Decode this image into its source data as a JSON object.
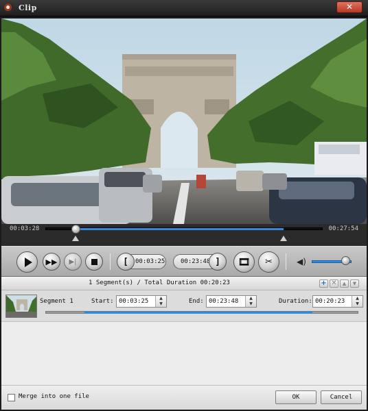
{
  "window": {
    "title": "Clip",
    "close_label": "✕"
  },
  "player": {
    "current_time": "00:03:28",
    "total_time": "00:27:54",
    "progress": 0.11,
    "trim_start_fraction": 0.11,
    "trim_end_fraction": 0.86,
    "start_time": "00:03:25",
    "end_time": "00:23:48",
    "volume": 0.85
  },
  "segments": {
    "summary": "1 Segment(s) / Total Duration 00:20:23",
    "items": [
      {
        "name": "Segment 1",
        "start_label": "Start:",
        "start": "00:03:25",
        "end_label": "End:",
        "end": "00:23:48",
        "duration_label": "Duration:",
        "duration": "00:20:23"
      }
    ]
  },
  "footer": {
    "merge_label": "Merge into one file",
    "merge_checked": false,
    "ok_label": "OK",
    "cancel_label": "Cancel"
  },
  "colors": {
    "accent": "#2e8de0",
    "close": "#c9432d"
  }
}
